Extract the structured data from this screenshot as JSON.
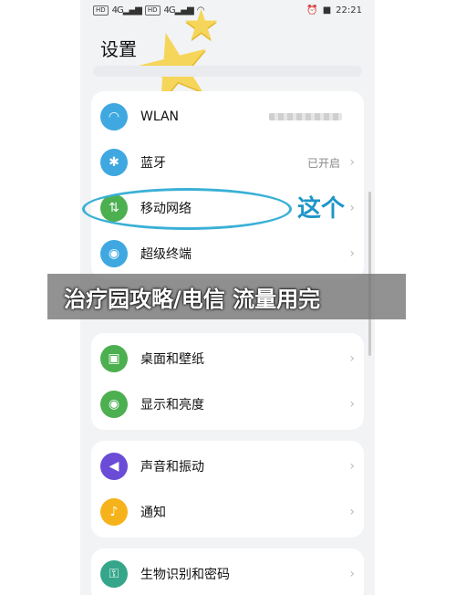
{
  "status_bar": {
    "hd1": "HD",
    "hd2": "HD",
    "signal1": "4G▂▄▆",
    "signal2": "4G▂▄▆",
    "wifi": "◠",
    "battery": "■",
    "time": "22:21"
  },
  "page": {
    "title": "设置"
  },
  "annotation": {
    "handwritten": "这个"
  },
  "banner": {
    "text": "治疗园攻略/电信 流量用完"
  },
  "colors": {
    "wlan": "#3fa8e0",
    "bluetooth": "#3fa8e0",
    "mobile": "#4caf50",
    "super": "#3fa8e0",
    "desktop": "#4caf50",
    "display": "#4caf50",
    "sound": "#6a4cd7",
    "notify": "#f6b21a",
    "biometric": "#35a68a"
  },
  "sections": [
    {
      "items": [
        {
          "label": "WLAN",
          "icon": "wifi-icon",
          "value": ""
        },
        {
          "label": "蓝牙",
          "icon": "bluetooth-icon",
          "value": "已开启"
        },
        {
          "label": "移动网络",
          "icon": "mobile-network-icon",
          "value": ""
        },
        {
          "label": "超级终端",
          "icon": "super-device-icon",
          "value": ""
        }
      ]
    },
    {
      "items": [
        {
          "label": "桌面和壁纸",
          "icon": "wallpaper-icon",
          "value": ""
        },
        {
          "label": "显示和亮度",
          "icon": "eye-icon",
          "value": ""
        }
      ]
    },
    {
      "items": [
        {
          "label": "声音和振动",
          "icon": "speaker-icon",
          "value": ""
        },
        {
          "label": "通知",
          "icon": "bell-icon",
          "value": ""
        }
      ]
    },
    {
      "items": [
        {
          "label": "生物识别和密码",
          "icon": "key-icon",
          "value": ""
        }
      ]
    }
  ]
}
